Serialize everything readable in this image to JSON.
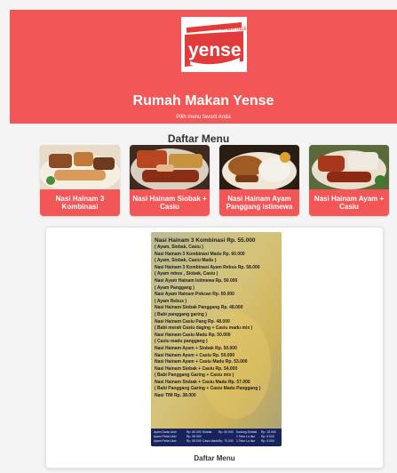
{
  "header": {
    "logo": {
      "top_text": "rumah makan",
      "word": "yense"
    },
    "title": "Rumah Makan Yense",
    "subtitle": "Pilih menu favorit Anda"
  },
  "section": {
    "title": "Daftar Menu"
  },
  "cards": [
    {
      "label": "Nasi Hainam 3 Kombinasi",
      "icon": "food-photo"
    },
    {
      "label": "Nasi Hainam Siobak + Casiu",
      "icon": "food-photo"
    },
    {
      "label": "Nasi Hainam Ayam Panggang istimewa",
      "icon": "food-photo"
    },
    {
      "label": "Nasi Hainam Ayam + Casiu",
      "icon": "food-photo"
    }
  ],
  "viewer": {
    "caption": "Daftar Menu",
    "menu_lines": [
      "Nasi Hainam 3 Kombinasi Rp. 55.000",
      "( Ayam, Siobak, Casiu )",
      "Nasi Hainam 3 Kombinasi Madu Rp. 60.000",
      "( Ayam, Siobak, Casiu Madu )",
      "Nasi Hainam 3 Kombinasi Ayam Rebus Rp. 58.000",
      "( Ayam rebus , Siobak, Casiu )",
      "Nasi Ayam Hainam Istimewa Rp. 50.000",
      "( Ayam Panggang )",
      "Nasi Ayam Hainam Pokcan Rp. 50.000",
      "( Ayam Rebus )",
      "Nasi Hainam Siobak Panggang Rp. 48.000",
      "( Babi panggang garing )",
      "Nasi Hainam Casiu Pang Rp. 48.000",
      "( Babi merah Casiu daging + Casiu madu mix )",
      "Nasi Hainam Casiu Madu Rp. 50.000",
      "( Casiu madu panggang )",
      "Nasi Hainam Ayam + Siobak Rp. 50.000",
      "Nasi Hainam Ayam + Casiu Rp. 50.000",
      "Nasi Hainam Ayam + Casiu Madu Rp. 53.000",
      "Nasi Hainam Siobak + Casiu Rp. 54.000",
      "( Babi Panggang Garing + Casiu mix )",
      "Nasi Hainam Siobak + Casiu Madu Rp. 57.000",
      "( Babi Panggang Garing + Casiu Madu Panggang )",
      "Nasi TIM Rp. 38.000"
    ],
    "menu_footer": [
      "Ayam Dada Utuh",
      "Rp. 60.000",
      "Ayam Paha Utuh",
      "Rp. 55.000",
      "Ayam Paha Utuh",
      "Rp. 55.000",
      "Siobak",
      "Rp. 60.000",
      "Kudong Dimbal",
      "Rp. 15.000",
      "1 Telur Lu Ikur",
      "Rp. 5.000",
      "1 Telur Lu Ikur",
      "Rp. 5.000",
      "Casiu Madu",
      "Rp. 70.000"
    ]
  },
  "colors": {
    "brand_red": "#f25656",
    "background": "#f4f4f4",
    "card_background": "#ffffff"
  }
}
